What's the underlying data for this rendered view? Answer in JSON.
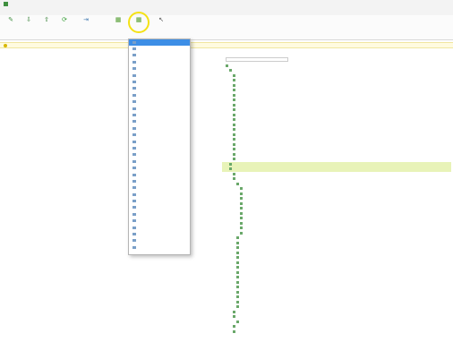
{
  "window": {
    "title": "",
    "accent": "#3d8ee6",
    "highlight_color": "#f4e215"
  },
  "tabs": [
    {
      "label": ""
    },
    {
      "label": ""
    },
    {
      "label": ""
    },
    {
      "label": ""
    }
  ],
  "ribbon": {
    "buttons": [
      {
        "icon": "new-icon",
        "label": ""
      },
      {
        "icon": "download-icon",
        "label": ""
      },
      {
        "icon": "upload-icon",
        "label": ""
      },
      {
        "icon": "refresh-icon",
        "label": ""
      },
      {
        "icon": "export-icon",
        "label": ""
      },
      {
        "icon": "grid-icon",
        "label": ""
      },
      {
        "icon": "grid-icon",
        "label": ""
      },
      {
        "icon": "pointer-icon",
        "label": ""
      }
    ]
  },
  "infobar": {
    "text": ""
  },
  "left_panel": {
    "title": "",
    "rows": [
      {
        "text": ""
      },
      {
        "text": ""
      },
      {
        "text": ""
      },
      {
        "text": ""
      },
      {
        "text": ""
      },
      {
        "text": ""
      },
      {
        "text": ""
      },
      {
        "text": ""
      },
      {
        "text": ""
      },
      {
        "text": ""
      },
      {
        "text": ""
      },
      {
        "text": ""
      },
      {
        "text": ""
      },
      {
        "text": ""
      },
      {
        "text": ""
      },
      {
        "text": ""
      },
      {
        "text": ""
      }
    ]
  },
  "dropdown": {
    "items": [
      {
        "label": "",
        "selected": true
      },
      {
        "label": ""
      },
      {
        "label": ""
      },
      {
        "label": ""
      },
      {
        "label": ""
      },
      {
        "label": ""
      },
      {
        "label": ""
      },
      {
        "label": ""
      },
      {
        "label": ""
      },
      {
        "label": ""
      },
      {
        "label": ""
      },
      {
        "label": ""
      },
      {
        "label": ""
      },
      {
        "label": ""
      },
      {
        "label": ""
      },
      {
        "label": ""
      },
      {
        "label": ""
      },
      {
        "label": ""
      },
      {
        "label": ""
      },
      {
        "label": ""
      },
      {
        "label": ""
      },
      {
        "label": ""
      },
      {
        "label": ""
      },
      {
        "label": ""
      },
      {
        "label": ""
      },
      {
        "label": ""
      },
      {
        "label": ""
      },
      {
        "label": ""
      },
      {
        "label": ""
      },
      {
        "label": ""
      },
      {
        "label": ""
      },
      {
        "label": ""
      }
    ]
  },
  "tree": {
    "search_placeholder": "",
    "rows": [
      {
        "text": ""
      },
      {
        "text": ""
      },
      {
        "text": ""
      },
      {
        "text": ""
      },
      {
        "text": ""
      },
      {
        "text": ""
      },
      {
        "text": ""
      },
      {
        "text": ""
      },
      {
        "text": ""
      },
      {
        "text": ""
      },
      {
        "text": ""
      },
      {
        "text": ""
      },
      {
        "text": ""
      },
      {
        "text": ""
      },
      {
        "text": ""
      },
      {
        "text": ""
      },
      {
        "text": ""
      },
      {
        "text": ""
      },
      {
        "text": ""
      },
      {
        "text": ""
      },
      {
        "text": "",
        "highlighted": true
      },
      {
        "text": "",
        "highlighted": true
      },
      {
        "text": ""
      },
      {
        "text": ""
      },
      {
        "text": ""
      },
      {
        "text": ""
      },
      {
        "text": ""
      },
      {
        "text": ""
      },
      {
        "text": ""
      },
      {
        "text": ""
      },
      {
        "text": ""
      },
      {
        "text": ""
      },
      {
        "text": ""
      },
      {
        "text": ""
      },
      {
        "text": ""
      },
      {
        "text": ""
      },
      {
        "text": ""
      },
      {
        "text": ""
      },
      {
        "text": ""
      },
      {
        "text": ""
      },
      {
        "text": ""
      },
      {
        "text": ""
      },
      {
        "text": ""
      },
      {
        "text": ""
      },
      {
        "text": ""
      },
      {
        "text": ""
      },
      {
        "text": ""
      },
      {
        "text": ""
      },
      {
        "text": ""
      },
      {
        "text": ""
      },
      {
        "text": ""
      },
      {
        "text": ""
      },
      {
        "text": ""
      },
      {
        "text": ""
      },
      {
        "text": ""
      }
    ]
  }
}
